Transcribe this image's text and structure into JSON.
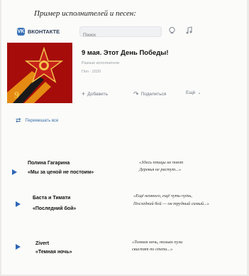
{
  "heading": "Пример исполнителей и песен:",
  "topbar": {
    "brand": "ВКОНТАКТЕ",
    "search_placeholder": "Поиск",
    "icons": [
      "bell-icon",
      "music-note-icon"
    ]
  },
  "album": {
    "title": "9 мая. Этот День Победы!",
    "artists": "Разные исполнители",
    "meta": "Поп · 2020",
    "actions": {
      "add": "Добавить",
      "share": "Поделиться",
      "more": "Ещё"
    }
  },
  "shuffle_label": "Перемешать все",
  "tracks": [
    {
      "artist": "Полина Гагарина",
      "song": "«Мы за ценой не постоим»",
      "lyric1": "«Здесь птицы не поют",
      "lyric2": "Деревья не растут...»"
    },
    {
      "artist": "Баста и Тимати",
      "song": "«Последний бой»",
      "lyric1": "«Ещё немного, ещё чуть-чуть,",
      "lyric2": "Последний бой — он трудный самый...»"
    },
    {
      "artist": "Zivert",
      "song": "«Темная ночь»",
      "lyric1": "«Темная ночь, только пули",
      "lyric2": "свистят по степи...»"
    }
  ],
  "colors": {
    "accent": "#2f66b7",
    "cover_red": "#b80f0d",
    "ribbon_orange": "#e58a12"
  }
}
